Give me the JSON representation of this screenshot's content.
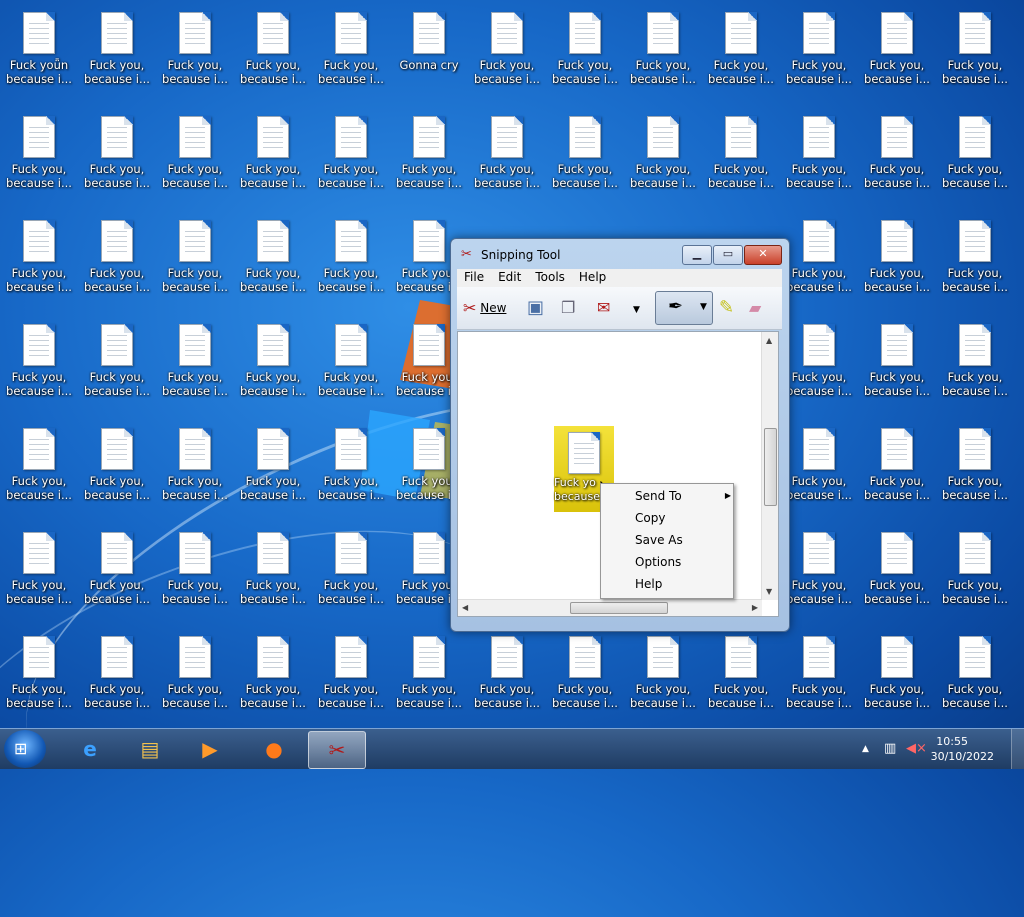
{
  "desktop": {
    "label_default": "Fuck you,\nbecause i...",
    "label_special": "Gonna cry",
    "label_first": "Fuck yoǖn\nbecause i..."
  },
  "snipping_tool": {
    "title": "Snipping Tool",
    "menu": [
      "File",
      "Edit",
      "Tools",
      "Help"
    ],
    "toolbar": {
      "new_label": "New"
    },
    "snipped_label": "Fuck yo\nbecause"
  },
  "context_menu": {
    "items": [
      "Send To",
      "Copy",
      "Save As",
      "Options",
      "Help"
    ]
  },
  "taskbar": {
    "time": "10:55",
    "date": "30/10/2022"
  },
  "colors": {
    "accent": "#1768c7",
    "close_button": "#c9412a",
    "snip_highlight": "#f4e23a"
  }
}
